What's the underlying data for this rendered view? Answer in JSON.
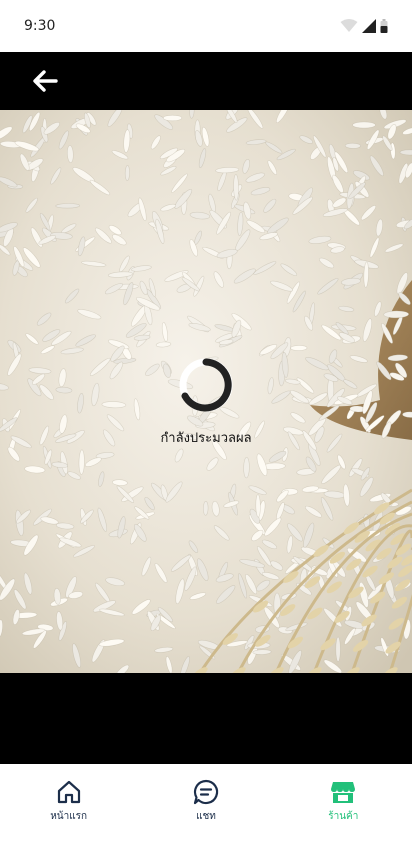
{
  "status_bar": {
    "time": "9:30"
  },
  "loading": {
    "text": "กำลังประมวลผล"
  },
  "bottom_nav": {
    "items": [
      {
        "label": "หน้าแรก",
        "icon": "home-icon"
      },
      {
        "label": "แชท",
        "icon": "chat-icon"
      },
      {
        "label": "ร้านค้า",
        "icon": "store-icon"
      }
    ],
    "active_index": 2,
    "active_color": "#22c07a",
    "inactive_color": "#1c2e4a"
  }
}
